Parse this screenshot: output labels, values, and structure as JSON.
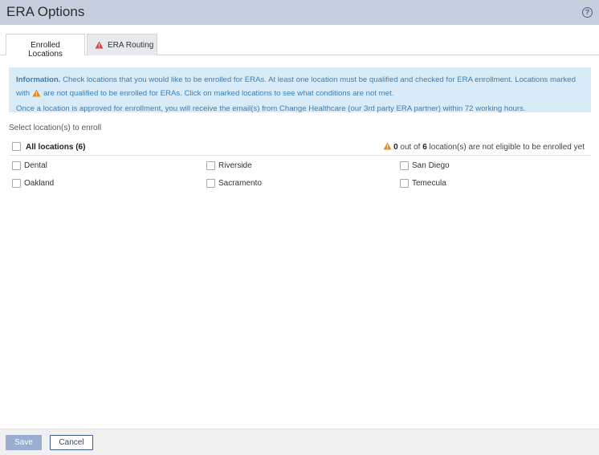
{
  "window": {
    "title": "ERA Options",
    "help_icon": "?"
  },
  "tabs": [
    {
      "label": "Enrolled Locations",
      "active": true
    },
    {
      "label": "ERA Routing",
      "active": false,
      "icon": "warning-triangle-icon"
    }
  ],
  "info": {
    "heading": "Information.",
    "text1": " Check locations that you would like to be enrolled for ERAs. At least one location must be qualified and checked for ERA enrollment. Locations marked",
    "text2_before": "with",
    "text2_after": "are not qualified to be enrolled for ERAs. Click on marked locations to see what conditions are not met.",
    "text3": "Once a location is approved for enrollment, you will receive the email(s) from Change Healthcare (our 3rd party ERA partner) within 72 working hours."
  },
  "select_label": "Select location(s) to enroll",
  "all_locations": {
    "label": "All locations (6)",
    "checked": false
  },
  "eligibility": {
    "count": "0",
    "text_mid": " out of ",
    "total": "6",
    "text_end": " location(s) are not eligible to be enrolled yet"
  },
  "locations": [
    {
      "name": "Dental",
      "checked": false
    },
    {
      "name": "Riverside",
      "checked": false
    },
    {
      "name": "San Diego",
      "checked": false
    },
    {
      "name": "Oakland",
      "checked": false
    },
    {
      "name": "Sacramento",
      "checked": false
    },
    {
      "name": "Temecula",
      "checked": false
    }
  ],
  "buttons": {
    "save": "Save",
    "cancel": "Cancel"
  },
  "colors": {
    "title_bar": "#c7cfdf",
    "info_bg": "#d8ebf7",
    "info_text": "#3a7fb5",
    "warning_red": "#d64545",
    "warning_orange": "#e88a1a",
    "save_btn": "#99aed0"
  }
}
